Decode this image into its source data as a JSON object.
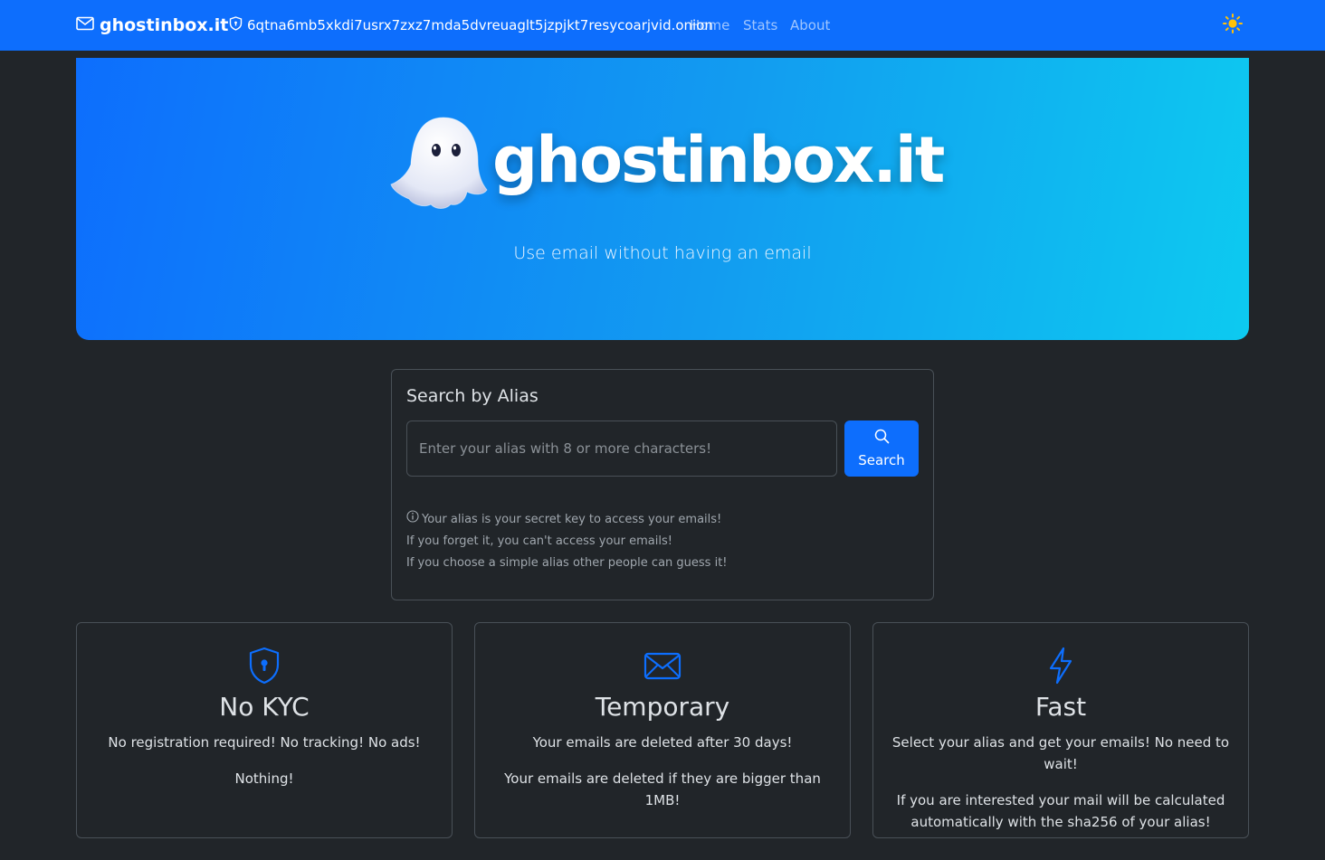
{
  "navbar": {
    "brand": "ghostinbox.it",
    "onion": "6qtna6mb5xkdi7usrx7zxz7mda5dvreuaglt5jzpjkt7resycoarjvid.onion",
    "links": [
      "Home",
      "Stats",
      "About"
    ],
    "icons": {
      "brand": "envelope-icon",
      "onion": "shield-icon",
      "theme": "sun-icon"
    }
  },
  "hero": {
    "logo_text": "ghostinbox.it",
    "tagline": "Use email without having an email"
  },
  "search": {
    "title": "Search by Alias",
    "placeholder": "Enter your alias with 8 or more characters!",
    "button_label": "Search",
    "notes": [
      "Your alias is your secret key to access your emails!",
      "If you forget it, you can't access your emails!",
      "If you choose a simple alias other people can guess it!"
    ]
  },
  "features": [
    {
      "icon": "shield-lock-icon",
      "title": "No KYC",
      "lines": [
        "No registration required! No tracking! No ads!",
        "Nothing!"
      ]
    },
    {
      "icon": "envelope-icon",
      "title": "Temporary",
      "lines": [
        "Your emails are deleted after 30 days!",
        "Your emails are deleted if they are bigger than 1MB!"
      ]
    },
    {
      "icon": "lightning-icon",
      "title": "Fast",
      "lines": [
        "Select your alias and get your emails! No need to wait!",
        "If you are interested your mail will be calculated automatically with the sha256 of your alias!"
      ]
    }
  ],
  "colors": {
    "primary": "#0d6efd",
    "cyan": "#0dcaf0",
    "background": "#212529",
    "border": "#495057",
    "sun": "#ffc107"
  }
}
